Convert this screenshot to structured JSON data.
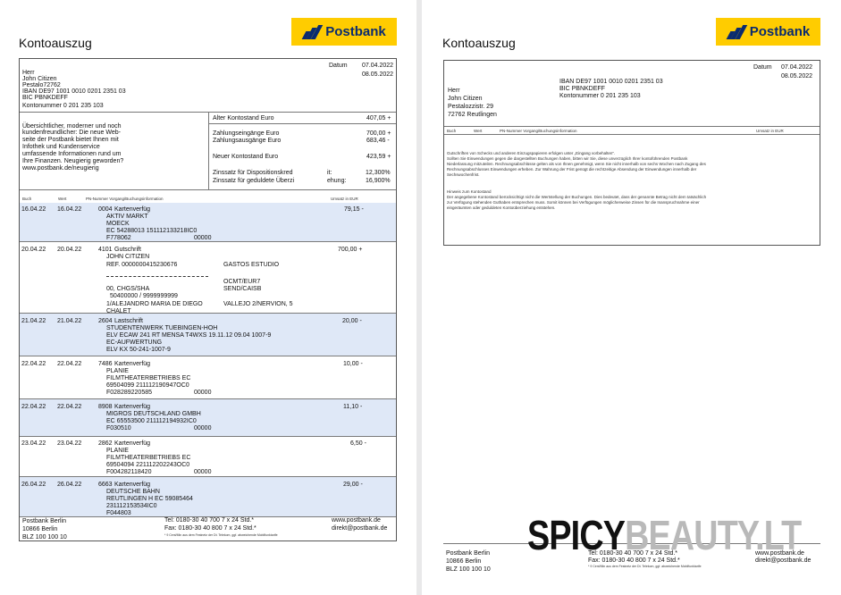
{
  "brand": {
    "name": "Postbank",
    "color": "#ffcc00",
    "logo_color": "#0a2b70"
  },
  "page1": {
    "title": "Kontoauszug",
    "datum_label": "Datum",
    "dates": [
      "07.04.2022",
      "08.05.2022"
    ],
    "address": [
      "Herr",
      "John Citizen",
      "Pestalo72762",
      "IBAN  DE97 1001 0010 0201 2351 03",
      "BIC    PBNKDEFF",
      "Kontonummer  0 201 235 103"
    ],
    "info_text": [
      "Übersichtlicher, moderner und noch",
      "kundenfreundlicher: Die neue Web-",
      "seite der Postbank bietet Ihnen mit",
      "Infothek und Kundenservice",
      "umfassende Informationen rund um",
      "Ihre Finanzen. Neugierig geworden?",
      "www.postbank.de/neugierig"
    ],
    "balances": [
      {
        "label": "Alter Kontostand Euro",
        "value": "407,05 +"
      },
      {
        "label": "Zahlungseingänge Euro",
        "value": "700,00 +"
      },
      {
        "label": "Zahlungsausgänge Euro",
        "value": "683,46 -"
      },
      {
        "label": "Neuer Kontostand Euro",
        "value": "423,59 +"
      },
      {
        "label": "Zinssatz für Dispositionskred",
        "mid": "it:",
        "value": "12,300%"
      },
      {
        "label": "Zinssatz für geduldete Überzi",
        "mid": "ehung:",
        "value": "16,900%"
      }
    ],
    "table_headers": [
      "Buch",
      "Wert",
      "PN-Nummer  Vorgang/Buchungsinformation",
      "Umsatz in EUR"
    ],
    "transactions": [
      {
        "buch": "16.04.22",
        "wert": "16.04.22",
        "pn": "0004",
        "type": "Kartenverfüg",
        "lines": [
          "AKTIV MARKT",
          "MOECK",
          "EC 54288013 151112133218IC0"
        ],
        "ref": "F778062",
        "code": "00000",
        "amount": "79,15 -",
        "extra": []
      },
      {
        "buch": "20.04.22",
        "wert": "20.04.22",
        "pn": "4101",
        "type": "Gutschrift",
        "lines": [
          "JOHN CITIZEN",
          "REF.    0000000415230676"
        ],
        "ref": "",
        "code": "",
        "amount": "700,00 +",
        "extra": [
          "GASTOS ESTUDIO",
          "OCMT/EUR7",
          "SEND/CAISB",
          "00, CHGS/SHA",
          "50400000 / 9999999999",
          "1/ALEJANDRO MARIA DE DIEGO",
          "VALLEJO 2/NERVION, 5",
          "CHALET"
        ]
      },
      {
        "buch": "21.04.22",
        "wert": "21.04.22",
        "pn": "2604",
        "type": "Lastschrift",
        "lines": [
          "STUDENTENWERK TUEBINGEN-HOH",
          "ELV ECAW 241 RT MENSA T4WXS 19.11.12 09.04 1007-9",
          "EC-AUFWERTUNG",
          "ELV KX 50-241-1007-9"
        ],
        "ref": "",
        "code": "",
        "amount": "20,00 -",
        "extra": []
      },
      {
        "buch": "22.04.22",
        "wert": "22.04.22",
        "pn": "7486",
        "type": "Kartenverfüg",
        "lines": [
          "PLANIE",
          "FILMTHEATERBETRIEBS EC",
          "69504099 211112190947OC0"
        ],
        "ref": "F028289220585",
        "code": "00000",
        "amount": "10,00 -",
        "extra": []
      },
      {
        "buch": "22.04.22",
        "wert": "22.04.22",
        "pn": "8908",
        "type": "Kartenverfüg",
        "lines": [
          "MIGROS DEUTSCHLAND GMBH",
          "EC 65553500 211112194932IC0"
        ],
        "ref": "F030510",
        "code": "00000",
        "amount": "11,10 -",
        "extra": []
      },
      {
        "buch": "23.04.22",
        "wert": "23.04.22",
        "pn": "2862",
        "type": "Kartenverfüg",
        "lines": [
          "PLANIE",
          "FILMTHEATERBETRIEBS EC",
          "69504094 221112202243OC0"
        ],
        "ref": "F004282118420",
        "code": "00000",
        "amount": "6,50 -",
        "extra": []
      },
      {
        "buch": "26.04.22",
        "wert": "26.04.22",
        "pn": "6663",
        "type": "Kartenverfüg",
        "lines": [
          "DEUTSCHE BAHN",
          "REUTLINGEN H EC 59085464",
          "231112153534IC0"
        ],
        "ref": "F044803",
        "code": "00000",
        "amount": "29,00 -",
        "extra": []
      }
    ],
    "footer": {
      "left": [
        "Postbank Berlin",
        "10866 Berlin",
        "BLZ 100 100 10"
      ],
      "mid": [
        "Tel: 0180-30 40 700 7 x 24 Std.*",
        "Fax: 0180-30 40 800 7 x 24 Std.*"
      ],
      "note": "* 9 Cent/Min aus dem Festnetz der Dt. Telekom, ggf. abweichende Mobilfunktarife",
      "right": [
        "www.postbank.de",
        "direkt@postbank.de"
      ]
    }
  },
  "page2": {
    "title": "Kontoauszug",
    "datum_label": "Datum",
    "dates": [
      "07.04.2022",
      "08.05.2022"
    ],
    "iban": "IBAN  DE97 1001 0010 0201        2351  03",
    "bic": "BIC    PBNKDEFF",
    "konto": "Kontonummer  0 201 235 103",
    "address": [
      "Herr",
      "John Citizen",
      "Pestalozzistr. 29",
      "72762 Reutlingen"
    ],
    "table_headers": [
      "Buch",
      "Wert",
      "PN-Nummer  Vorgang/Buchungsinformation",
      "Umsatz in EUR"
    ],
    "para1": [
      "Gutschriften von Schecks und anderen Einzugspapieren erfolgen unter „Eingang vorbehalten\".",
      "Sollten Sie Einwendungen gegen die dargestellten Buchungen haben, bitten wir Sie, diese unverzüglich Ihrer kontoführenden Postbank",
      "Niederlassung mitzuteilen. Rechnungsabschlüsse gelten als von Ihnen genehmigt, wenn Sie nicht innerhalb von sechs Wochen nach Zugang des",
      "Rechnungsabschlusses Einwendungen erheben. Zur Wahrung der Frist genügt die rechtzeitige Absendung der Einwendungen innerhalb der",
      "Sechswochenfrist."
    ],
    "para2": [
      "Hinweis zum Kontostand",
      "Der angegebene Kontostand berücksichtigt nicht die Wertstellung der Buchungen. Dies bedeutet, dass der genannte Betrag nicht dem tatsächlich",
      "zur Verfügung stehenden Guthaben entsprechen muss. Somit können bei Verfügungen möglicherweise Zinsen für die Inanspruchnahme einer",
      "eingeräumten oder geduldeten Kontoüberziehung entstehen."
    ],
    "footer": {
      "left": [
        "Postbank Berlin",
        "10866 Berlin",
        "BLZ 100 100 10"
      ],
      "mid": [
        "Tel: 0180-30 40 700 7 x 24 Std.*",
        "Fax: 0180-30 40 800 7 x 24 Std.*"
      ],
      "note": "* 9 Cent/Min aus dem Festnetz der Dt. Telekom, ggf. abweichende Mobilfunktarife",
      "right": [
        "www.postbank.de",
        "direkt@postbank.de"
      ]
    }
  },
  "watermark": {
    "part1": "SPICY",
    "part2": "BEAUTY.LT"
  }
}
